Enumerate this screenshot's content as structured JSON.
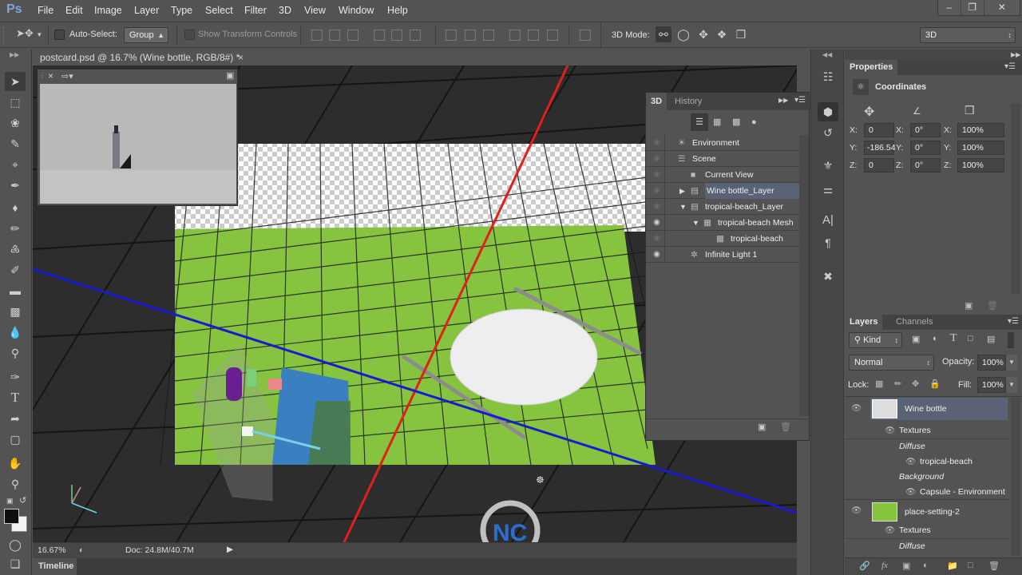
{
  "app": {
    "logo": "Ps"
  },
  "menu": [
    "File",
    "Edit",
    "Image",
    "Layer",
    "Type",
    "Select",
    "Filter",
    "3D",
    "View",
    "Window",
    "Help"
  ],
  "window_controls": {
    "minimize": "–",
    "restore": "❐",
    "close": "✕"
  },
  "options": {
    "auto_select_label": "Auto-Select:",
    "auto_select_checked": false,
    "group_value": "Group",
    "show_transform_label": "Show Transform Controls",
    "mode3d_label": "3D Mode:",
    "workspace_value": "3D"
  },
  "document": {
    "tab_title": "postcard.psd @ 16.7% (Wine bottle, RGB/8#) *",
    "zoom": "16.67%",
    "doc_size": "Doc: 24.8M/40.7M",
    "timeline_label": "Timeline"
  },
  "panel3d": {
    "tabs": [
      "3D",
      "History"
    ],
    "active_tab": "3D",
    "rows": [
      {
        "label": "Environment",
        "icon": "environment-icon",
        "indent": 0,
        "expander": "",
        "visible": false
      },
      {
        "label": "Scene",
        "icon": "scene-icon",
        "indent": 0,
        "expander": "",
        "visible": false
      },
      {
        "label": "Current View",
        "icon": "camera-icon",
        "indent": 1,
        "expander": "",
        "visible": false
      },
      {
        "label": "Wine bottle_Layer",
        "icon": "layer-folder-icon",
        "indent": 1,
        "expander": "▶",
        "visible": false,
        "selected": true
      },
      {
        "label": "tropical-beach_Layer",
        "icon": "layer-folder-icon",
        "indent": 1,
        "expander": "▼",
        "visible": false
      },
      {
        "label": "tropical-beach Mesh",
        "icon": "mesh-icon",
        "indent": 2,
        "expander": "▼",
        "visible": true
      },
      {
        "label": "tropical-beach",
        "icon": "material-icon",
        "indent": 3,
        "expander": "",
        "visible": false
      },
      {
        "label": "Infinite Light 1",
        "icon": "light-icon",
        "indent": 1,
        "expander": "",
        "visible": true
      }
    ]
  },
  "properties": {
    "tab": "Properties",
    "section": "Coordinates",
    "position": {
      "X": "0",
      "Y": "-186.54",
      "Z": "0"
    },
    "rotation": {
      "X": "0°",
      "Y": "0°",
      "Z": "0°"
    },
    "scale": {
      "X": "100%",
      "Y": "100%",
      "Z": "100%"
    }
  },
  "layers": {
    "tabs": [
      "Layers",
      "Channels"
    ],
    "filter_value": "Kind",
    "blend_mode": "Normal",
    "opacity_label": "Opacity:",
    "opacity_value": "100%",
    "lock_label": "Lock:",
    "fill_label": "Fill:",
    "fill_value": "100%",
    "items": [
      {
        "name": "Wine bottle",
        "selected": true,
        "textures": "Textures",
        "diffuse": "Diffuse",
        "diffuse_tex": "tropical-beach",
        "background": "Background",
        "background_tex": "Capsule - Environment"
      },
      {
        "name": "place-setting-2",
        "selected": false,
        "textures": "Textures",
        "diffuse": "Diffuse"
      }
    ]
  },
  "colors": {
    "accent_selection": "#5a6375",
    "x_axis": "#e0201a",
    "z_axis": "#1a1ad0",
    "floor_green": "#86c440"
  }
}
